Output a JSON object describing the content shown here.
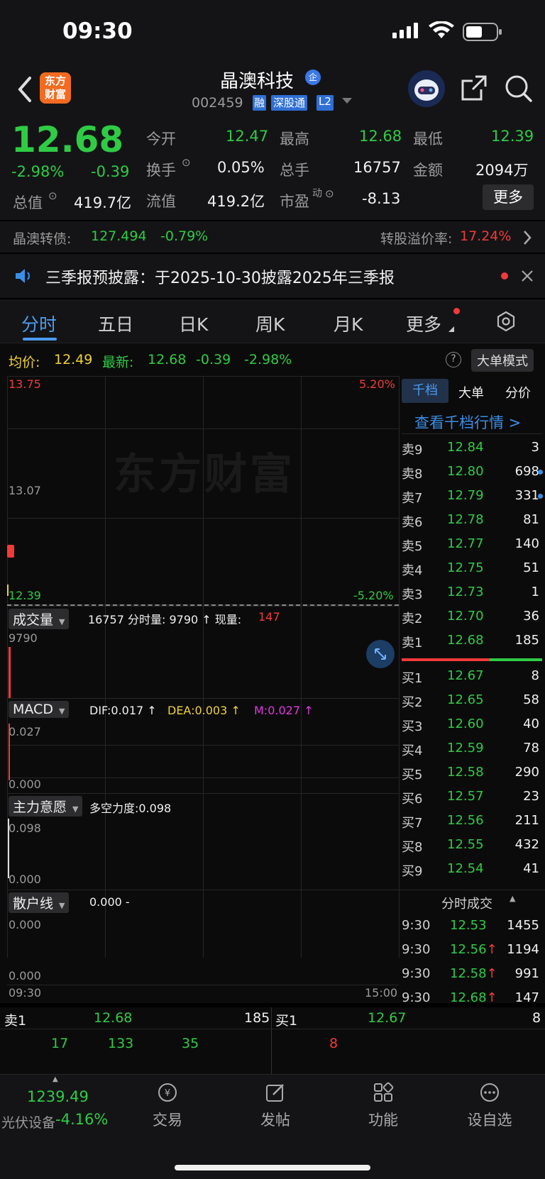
{
  "status_bar": {
    "time": "09:30"
  },
  "header": {
    "logo_text": "东方财富",
    "title": "晶澳科技",
    "enterprise_badge": "企",
    "code": "002459",
    "tags": [
      "融",
      "深股通",
      "L2"
    ]
  },
  "quote": {
    "price": "12.68",
    "change_pct": "-2.98%",
    "change": "-0.39",
    "cells": [
      {
        "label": "今开",
        "value": "12.47"
      },
      {
        "label": "最高",
        "value": "12.68"
      },
      {
        "label": "最低",
        "value": "12.39"
      },
      {
        "label": "换手",
        "value": "0.05%"
      },
      {
        "label": "总手",
        "value": "16757"
      },
      {
        "label": "金额",
        "value": "2094万"
      },
      {
        "label": "总值",
        "value": "419.7亿"
      },
      {
        "label": "流值",
        "value": "419.2亿"
      },
      {
        "label": "市盈",
        "sup": "动",
        "value": "-8.13"
      }
    ],
    "more_button": "更多"
  },
  "bond": {
    "label": "晶澳转债:",
    "price": "127.494",
    "change": "-0.79%",
    "premium_label": "转股溢价率:",
    "premium_value": "17.24%"
  },
  "notice": {
    "text": "三季报预披露：于2025-10-30披露2025年三季报"
  },
  "tabs": [
    "分时",
    "五日",
    "日K",
    "周K",
    "月K",
    "更多"
  ],
  "info_line": {
    "avg_label": "均价:",
    "avg_value": "12.49",
    "latest_label": "最新:",
    "latest_value": "12.68",
    "change": "-0.39",
    "change_pct": "-2.98%",
    "mode_button": "大单模式"
  },
  "chart": {
    "price_high": "13.75",
    "pct_high": "5.20%",
    "price_mid": "13.07",
    "price_low": "12.39",
    "pct_low": "-5.20%",
    "watermark": "东方财富",
    "time_start": "09:30",
    "time_end": "15:00"
  },
  "volume_panel": {
    "label": "成交量",
    "info": "16757 分时量: 9790 ↑ 现量:",
    "now_vol": "147",
    "axis_max": "9790"
  },
  "macd_panel": {
    "label": "MACD",
    "dif": "DIF:0.017 ↑",
    "dea": "DEA:0.003 ↑",
    "m": "M:0.027 ↑",
    "axis_max": "0.027",
    "axis_min": "0.000"
  },
  "main_force_panel": {
    "label": "主力意愿",
    "info": "多空力度:0.098",
    "axis_max": "0.098",
    "axis_min": "0.000"
  },
  "retail_panel": {
    "label": "散户线",
    "info": "0.000 -",
    "axis_max": "0.000",
    "axis_min": "0.000"
  },
  "orderbook": {
    "tabs": [
      "千档",
      "大单",
      "分价"
    ],
    "view_link": "查看千档行情 >",
    "sells": [
      {
        "label": "卖9",
        "price": "12.84",
        "vol": "3"
      },
      {
        "label": "卖8",
        "price": "12.80",
        "vol": "698"
      },
      {
        "label": "卖7",
        "price": "12.79",
        "vol": "331"
      },
      {
        "label": "卖6",
        "price": "12.78",
        "vol": "81"
      },
      {
        "label": "卖5",
        "price": "12.77",
        "vol": "140"
      },
      {
        "label": "卖4",
        "price": "12.75",
        "vol": "51"
      },
      {
        "label": "卖3",
        "price": "12.73",
        "vol": "1"
      },
      {
        "label": "卖2",
        "price": "12.70",
        "vol": "36"
      },
      {
        "label": "卖1",
        "price": "12.68",
        "vol": "185"
      }
    ],
    "buys": [
      {
        "label": "买1",
        "price": "12.67",
        "vol": "8"
      },
      {
        "label": "买2",
        "price": "12.65",
        "vol": "58"
      },
      {
        "label": "买3",
        "price": "12.60",
        "vol": "40"
      },
      {
        "label": "买4",
        "price": "12.59",
        "vol": "78"
      },
      {
        "label": "买5",
        "price": "12.58",
        "vol": "290"
      },
      {
        "label": "买6",
        "price": "12.57",
        "vol": "23"
      },
      {
        "label": "买7",
        "price": "12.56",
        "vol": "211"
      },
      {
        "label": "买8",
        "price": "12.55",
        "vol": "432"
      },
      {
        "label": "买9",
        "price": "12.54",
        "vol": "41"
      }
    ],
    "ticks_title": "分时成交",
    "ticks": [
      {
        "time": "9:30",
        "price": "12.53",
        "arrow": "",
        "vol": "1455"
      },
      {
        "time": "9:30",
        "price": "12.56",
        "arrow": "↑",
        "vol": "1194"
      },
      {
        "time": "9:30",
        "price": "12.58",
        "arrow": "↑",
        "vol": "991"
      },
      {
        "time": "9:30",
        "price": "12.68",
        "arrow": "↑",
        "vol": "147"
      }
    ]
  },
  "queue": {
    "sell_label": "卖1",
    "sell_price": "12.68",
    "sell_vol": "185",
    "buy_label": "买1",
    "buy_price": "12.67",
    "buy_vol": "8",
    "sell_orders": [
      "17",
      "133",
      "35"
    ],
    "buy_orders": [
      "8"
    ]
  },
  "bottom": {
    "index_value": "1239.49",
    "index_name": "光伏设备",
    "index_change": "-4.16%",
    "nav": [
      "交易",
      "发帖",
      "功能",
      "设自选"
    ]
  }
}
